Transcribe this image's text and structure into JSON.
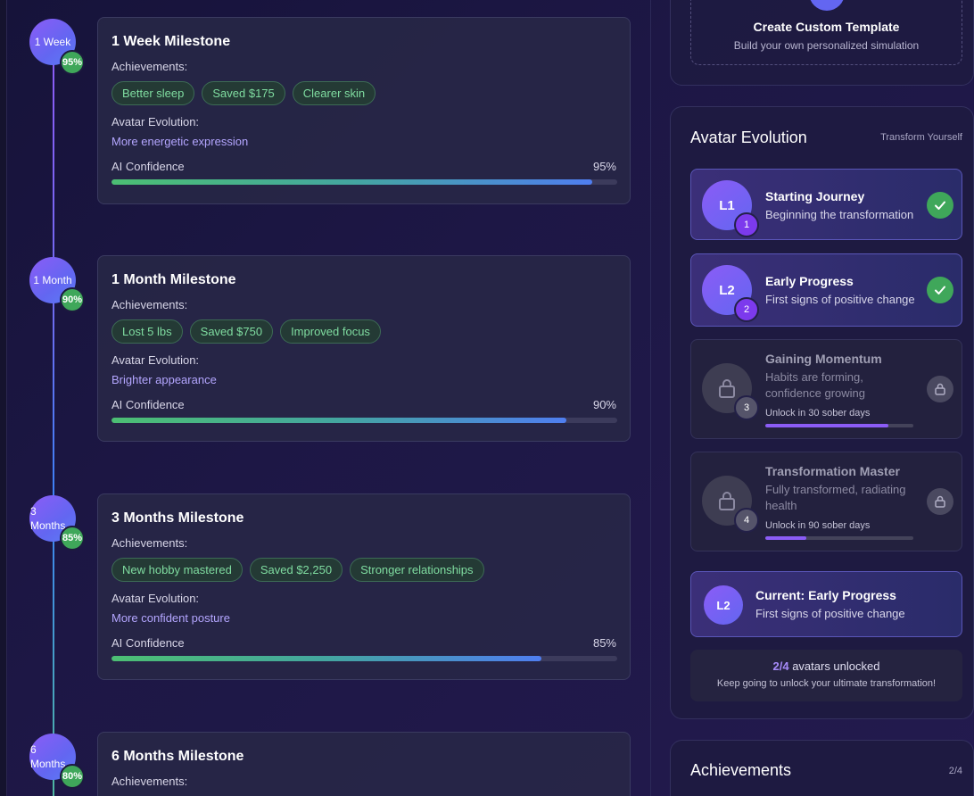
{
  "timeline": {
    "milestones": [
      {
        "node_label": "1 Week",
        "confidence_badge": "95%",
        "title": "1 Week Milestone",
        "achievements_label": "Achievements:",
        "achievements": [
          "Better sleep",
          "Saved $175",
          "Clearer skin"
        ],
        "evolution_label": "Avatar Evolution:",
        "evolution_text": "More energetic expression",
        "confidence_label": "AI Confidence",
        "confidence_value": "95%",
        "confidence_percent": 95
      },
      {
        "node_label": "1 Month",
        "confidence_badge": "90%",
        "title": "1 Month Milestone",
        "achievements_label": "Achievements:",
        "achievements": [
          "Lost 5 lbs",
          "Saved $750",
          "Improved focus"
        ],
        "evolution_label": "Avatar Evolution:",
        "evolution_text": "Brighter appearance",
        "confidence_label": "AI Confidence",
        "confidence_value": "90%",
        "confidence_percent": 90
      },
      {
        "node_label": "3 Months",
        "confidence_badge": "85%",
        "title": "3 Months Milestone",
        "achievements_label": "Achievements:",
        "achievements": [
          "New hobby mastered",
          "Saved $2,250",
          "Stronger relationships"
        ],
        "evolution_label": "Avatar Evolution:",
        "evolution_text": "More confident posture",
        "confidence_label": "AI Confidence",
        "confidence_value": "85%",
        "confidence_percent": 85
      },
      {
        "node_label": "6 Months",
        "confidence_badge": "80%",
        "title": "6 Months Milestone",
        "achievements_label": "Achievements:"
      }
    ]
  },
  "custom_template": {
    "title": "Create Custom Template",
    "subtitle": "Build your own personalized simulation"
  },
  "avatar_evolution": {
    "title": "Avatar Evolution",
    "tag": "Transform Yourself",
    "levels": [
      {
        "avatar": "L1",
        "number": "1",
        "title": "Starting Journey",
        "description": "Beginning the transformation",
        "status": "unlocked"
      },
      {
        "avatar": "L2",
        "number": "2",
        "title": "Early Progress",
        "description": "First signs of positive change",
        "status": "unlocked"
      },
      {
        "number": "3",
        "title": "Gaining Momentum",
        "description": "Habits are forming, confidence growing",
        "status": "locked",
        "unlock_text": "Unlock in 30 sober days",
        "unlock_progress": 0.83
      },
      {
        "number": "4",
        "title": "Transformation Master",
        "description": "Fully transformed, radiating health",
        "status": "locked",
        "unlock_text": "Unlock in 90 sober days",
        "unlock_progress": 0.28
      }
    ],
    "current": {
      "avatar": "L2",
      "title": "Current: Early Progress",
      "description": "First signs of positive change"
    },
    "summary": {
      "count": "2/4",
      "count_suffix": " avatars unlocked",
      "subtitle": "Keep going to unlock your ultimate transformation!"
    }
  },
  "achievements_panel": {
    "title": "Achievements",
    "count": "2/4"
  },
  "colors": {
    "accent": "#8b5cf6",
    "success": "#3fa75a",
    "tag_text": "#7fdca0",
    "evolution_text": "#b4a6ff"
  }
}
